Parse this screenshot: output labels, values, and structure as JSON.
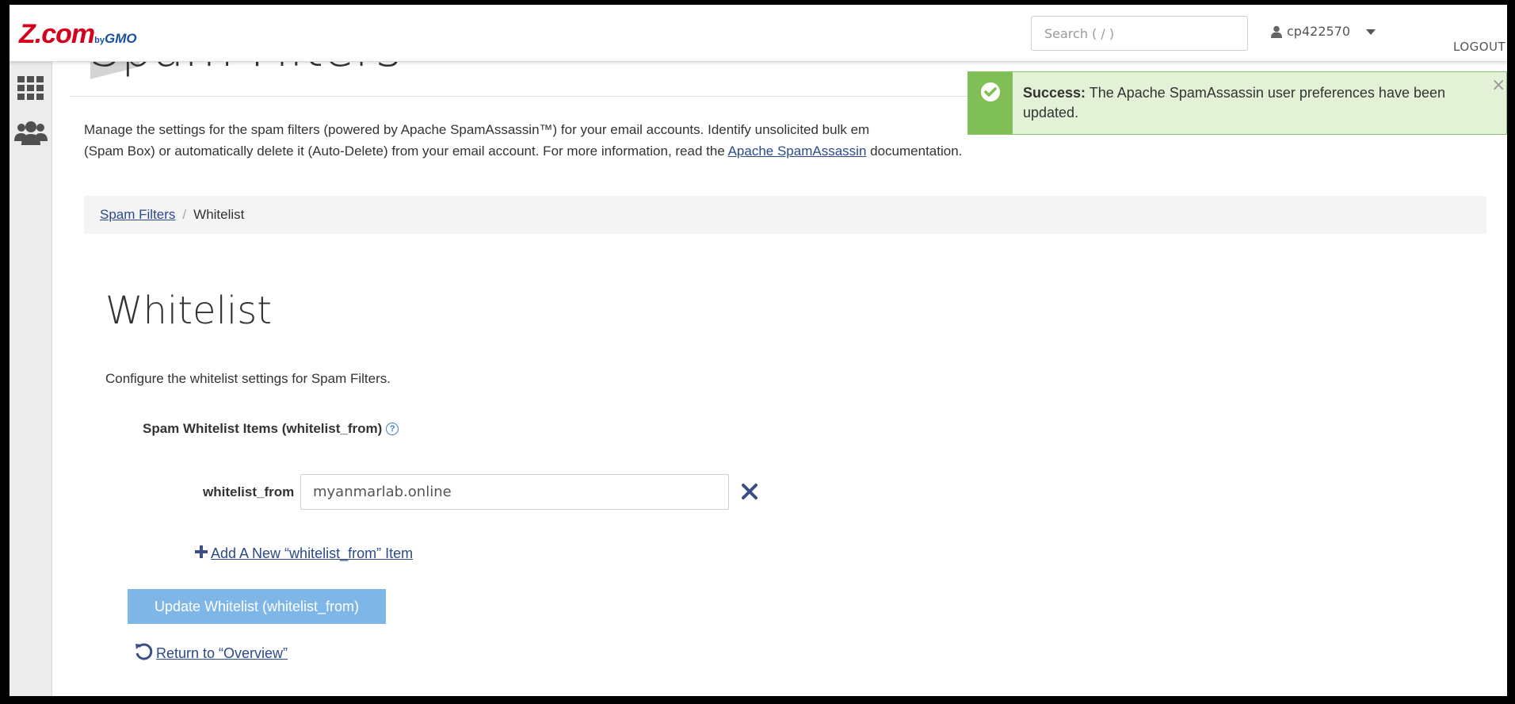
{
  "header": {
    "logo_main": "Z.com",
    "logo_by": "by",
    "logo_gmo": "GMO",
    "search_placeholder": "Search ( / )",
    "username": "cp422570",
    "logout_label": "LOGOUT"
  },
  "page": {
    "heading_partial": "Spam Filters",
    "intro_part1": "Manage the settings for the spam filters (powered by Apache SpamAssassin™) for your email accounts. Identify unsolicited bulk em",
    "intro_part2": "(Spam Box) or automatically delete it (Auto-Delete) from your email account. For more information, read the ",
    "intro_link": "Apache SpamAssassin",
    "intro_part3": " documentation."
  },
  "breadcrumb": {
    "parent": "Spam Filters",
    "separator": "/",
    "current": "Whitelist"
  },
  "section": {
    "title": "Whitelist",
    "description": "Configure the whitelist settings for Spam Filters.",
    "field_label": "Spam Whitelist Items (whitelist_from)",
    "help_icon": "?",
    "row_label": "whitelist_from",
    "row_value": "myanmarlab.online",
    "add_link": " Add A New “whitelist_from” Item",
    "update_button": "Update Whitelist (whitelist_from)",
    "return_link": " Return to “Overview”"
  },
  "alert": {
    "title": "Success:",
    "message": " The Apache SpamAssassin user preferences have been updated.",
    "close": "×"
  },
  "icons": {
    "sidebar": [
      "grid-icon",
      "users-icon"
    ],
    "header": [
      "user-icon",
      "caret-down-icon"
    ],
    "alert": "check-circle-icon"
  },
  "colors": {
    "link": "#2a4a8a",
    "update_button": "#7eb6e8",
    "alert_bg": "#e3f2d6",
    "alert_accent": "#7fbf55",
    "remove_icon": "#3b4f84",
    "brand_red": "#d6001c",
    "brand_blue": "#1a4fa0"
  }
}
